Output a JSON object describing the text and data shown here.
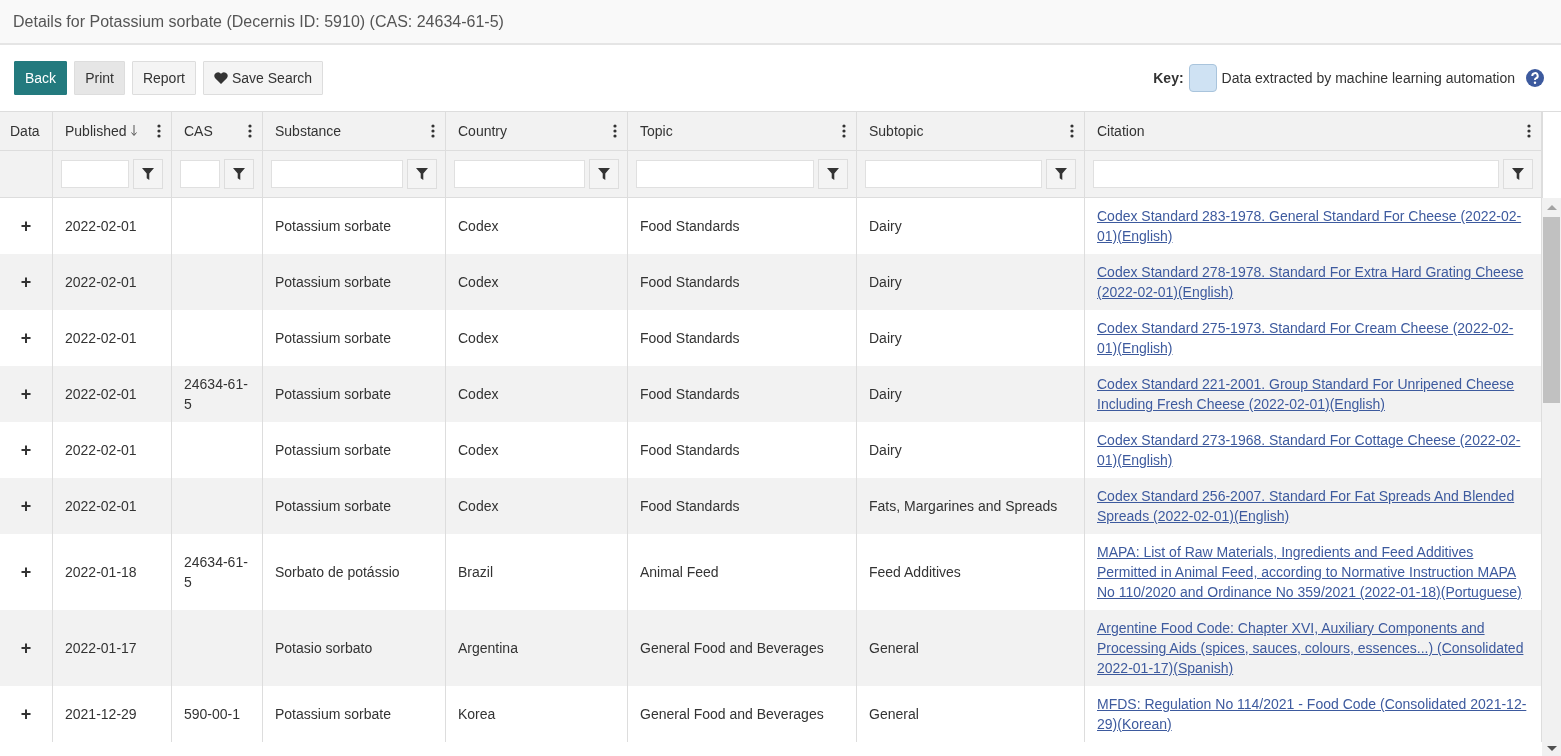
{
  "page_title": "Details for Potassium sorbate (Decernis ID: 5910) (CAS: 24634-61-5)",
  "toolbar": {
    "buttons": [
      {
        "label": "Back",
        "kind": "primary",
        "pressed": false
      },
      {
        "label": "Print",
        "kind": "default",
        "pressed": true
      },
      {
        "label": "Report",
        "kind": "default",
        "pressed": false
      },
      {
        "label": "Save Search",
        "kind": "heart",
        "pressed": false
      }
    ],
    "key": {
      "label": "Key:",
      "text": "Data extracted by machine learning automation"
    }
  },
  "table": {
    "columns": [
      {
        "label": "Data",
        "kind": "plain",
        "sorted": false
      },
      {
        "label": "Published",
        "kind": "filterable",
        "sorted": true
      },
      {
        "label": "CAS",
        "kind": "filterable",
        "sorted": false
      },
      {
        "label": "Substance",
        "kind": "filterable",
        "sorted": false
      },
      {
        "label": "Country",
        "kind": "filterable",
        "sorted": false
      },
      {
        "label": "Topic",
        "kind": "filterable",
        "sorted": false
      },
      {
        "label": "Subtopic",
        "kind": "filterable",
        "sorted": false
      },
      {
        "label": "Citation",
        "kind": "filterable",
        "sorted": false
      }
    ],
    "rows": [
      {
        "expand": "+",
        "published": "2022-02-01",
        "cas": "",
        "substance": "Potassium sorbate",
        "country": "Codex",
        "topic": "Food Standards",
        "subtopic": "Dairy",
        "citation": "Codex Standard 283-1978. General Standard For Cheese (2022-02-01)(English)"
      },
      {
        "expand": "+",
        "published": "2022-02-01",
        "cas": "",
        "substance": "Potassium sorbate",
        "country": "Codex",
        "topic": "Food Standards",
        "subtopic": "Dairy",
        "citation": "Codex Standard 278-1978. Standard For Extra Hard Grating Cheese (2022-02-01)(English)"
      },
      {
        "expand": "+",
        "published": "2022-02-01",
        "cas": "",
        "substance": "Potassium sorbate",
        "country": "Codex",
        "topic": "Food Standards",
        "subtopic": "Dairy",
        "citation": "Codex Standard 275-1973. Standard For Cream Cheese (2022-02-01)(English)"
      },
      {
        "expand": "+",
        "published": "2022-02-01",
        "cas": "24634-61-5",
        "substance": "Potassium sorbate",
        "country": "Codex",
        "topic": "Food Standards",
        "subtopic": "Dairy",
        "citation": "Codex Standard 221-2001. Group Standard For Unripened Cheese Including Fresh Cheese (2022-02-01)(English)"
      },
      {
        "expand": "+",
        "published": "2022-02-01",
        "cas": "",
        "substance": "Potassium sorbate",
        "country": "Codex",
        "topic": "Food Standards",
        "subtopic": "Dairy",
        "citation": "Codex Standard 273-1968. Standard For Cottage Cheese (2022-02-01)(English)"
      },
      {
        "expand": "+",
        "published": "2022-02-01",
        "cas": "",
        "substance": "Potassium sorbate",
        "country": "Codex",
        "topic": "Food Standards",
        "subtopic": "Fats, Margarines and Spreads",
        "citation": "Codex Standard 256-2007. Standard For Fat Spreads And Blended Spreads (2022-02-01)(English)"
      },
      {
        "expand": "+",
        "published": "2022-01-18",
        "cas": "24634-61-5",
        "substance": "Sorbato de potássio",
        "country": "Brazil",
        "topic": "Animal Feed",
        "subtopic": "Feed Additives",
        "citation": "MAPA: List of Raw Materials, Ingredients and Feed Additives Permitted in Animal Feed, according to Normative Instruction MAPA No 110/2020 and Ordinance No 359/2021 (2022-01-18)(Portuguese)"
      },
      {
        "expand": "+",
        "published": "2022-01-17",
        "cas": "",
        "substance": "Potasio sorbato",
        "country": "Argentina",
        "topic": "General Food and Beverages",
        "subtopic": "General",
        "citation": "Argentine Food Code: Chapter XVI, Auxiliary Components and Processing Aids (spices, sauces, colours, essences...) (Consolidated 2022-01-17)(Spanish)"
      },
      {
        "expand": "+",
        "published": "2021-12-29",
        "cas": "590-00-1",
        "substance": "Potassium sorbate",
        "country": "Korea",
        "topic": "General Food and Beverages",
        "subtopic": "General",
        "citation": "MFDS: Regulation No 114/2021 - Food Code (Consolidated 2021-12-29)(Korean)"
      }
    ]
  }
}
